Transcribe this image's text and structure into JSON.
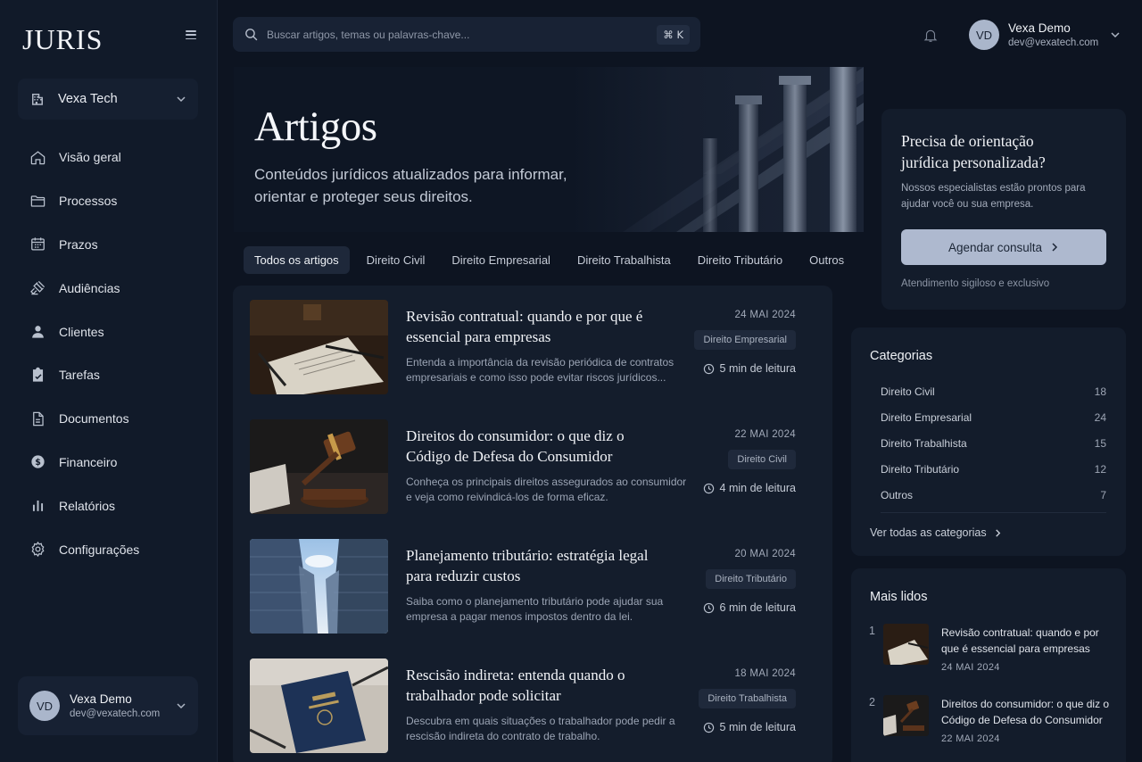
{
  "brand": {
    "logo": "JURIS"
  },
  "org": {
    "name": "Vexa Tech"
  },
  "nav": [
    {
      "label": "Visão geral",
      "icon": "home-icon"
    },
    {
      "label": "Processos",
      "icon": "folder-icon"
    },
    {
      "label": "Prazos",
      "icon": "calendar-icon"
    },
    {
      "label": "Audiências",
      "icon": "gavel-icon"
    },
    {
      "label": "Clientes",
      "icon": "user-icon"
    },
    {
      "label": "Tarefas",
      "icon": "checklist-icon"
    },
    {
      "label": "Documentos",
      "icon": "document-icon"
    },
    {
      "label": "Financeiro",
      "icon": "dollar-icon"
    },
    {
      "label": "Relatórios",
      "icon": "bar-chart-icon"
    },
    {
      "label": "Configurações",
      "icon": "gear-icon"
    }
  ],
  "user": {
    "initials": "VD",
    "name": "Vexa Demo",
    "email": "dev@vexatech.com"
  },
  "search": {
    "placeholder": "Buscar artigos, temas ou palavras-chave...",
    "shortcut": "⌘ K"
  },
  "hero": {
    "title": "Artigos",
    "subtitle": "Conteúdos jurídicos atualizados para informar, orientar e proteger seus direitos."
  },
  "tabs": [
    "Todos os artigos",
    "Direito Civil",
    "Direito Empresarial",
    "Direito Trabalhista",
    "Direito Tributário",
    "Outros"
  ],
  "articles": [
    {
      "title": "Revisão contratual: quando e por que é essencial para empresas",
      "desc": "Entenda a importância da revisão periódica de contratos empresariais e como isso pode evitar riscos jurídicos...",
      "date": "24 MAI 2024",
      "category": "Direito Empresarial",
      "read": "5 min de leitura"
    },
    {
      "title": "Direitos do consumidor: o que diz o Código de Defesa do Consumidor",
      "desc": "Conheça os principais direitos assegurados ao consumidor e veja como reivindicá-los de forma eficaz.",
      "date": "22 MAI 2024",
      "category": "Direito Civil",
      "read": "4 min de leitura"
    },
    {
      "title": "Planejamento tributário: estratégia legal para reduzir custos",
      "desc": "Saiba como o planejamento tributário pode ajudar sua empresa a pagar menos impostos dentro da lei.",
      "date": "20 MAI 2024",
      "category": "Direito Tributário",
      "read": "6 min de leitura"
    },
    {
      "title": "Rescisão indireta: entenda quando o trabalhador pode solicitar",
      "desc": "Descubra em quais situações o trabalhador pode pedir a rescisão indireta do contrato de trabalho.",
      "date": "18 MAI 2024",
      "category": "Direito Trabalhista",
      "read": "5 min de leitura"
    }
  ],
  "cta": {
    "title": "Precisa de orientação jurídica personalizada?",
    "text": "Nossos especialistas estão prontos para ajudar você ou sua empresa.",
    "button": "Agendar consulta",
    "note": "Atendimento sigiloso e exclusivo"
  },
  "categories": {
    "title": "Categorias",
    "items": [
      {
        "name": "Direito Civil",
        "count": "18"
      },
      {
        "name": "Direito Empresarial",
        "count": "24"
      },
      {
        "name": "Direito Trabalhista",
        "count": "15"
      },
      {
        "name": "Direito Tributário",
        "count": "12"
      },
      {
        "name": "Outros",
        "count": "7"
      }
    ],
    "more": "Ver todas as categorias"
  },
  "most_read": {
    "title": "Mais lidos",
    "items": [
      {
        "num": "1",
        "title": "Revisão contratual: quando e por que é essencial para empresas",
        "date": "24 MAI 2024"
      },
      {
        "num": "2",
        "title": "Direitos do consumidor: o que diz o Código de Defesa do Consumidor",
        "date": "22 MAI 2024"
      }
    ]
  }
}
